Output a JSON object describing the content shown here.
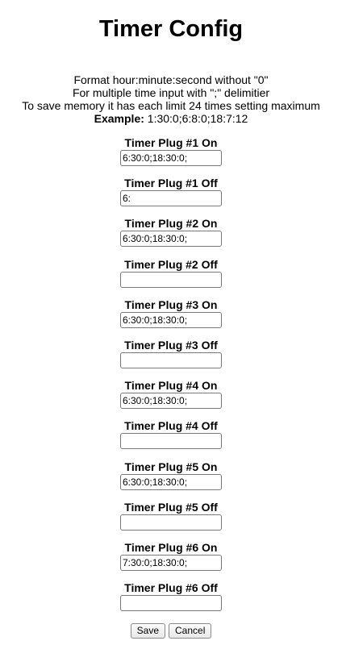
{
  "header": {
    "title": "Timer Config"
  },
  "info": {
    "line1": "Format hour:minute:second without \"0\"",
    "line2": "For multiple time input with \";\" delimitier",
    "line3": "To save memory it has each limit 24 times setting maximum",
    "example_label": "Example:",
    "example_value": " 1:30:0;6:8:0;18:7:12"
  },
  "plugs": [
    {
      "label": "Timer Plug #1 On",
      "value": "6:30:0;18:30:0;"
    },
    {
      "label": "Timer Plug #1 Off",
      "value": "6:"
    },
    {
      "label": "Timer Plug #2 On",
      "value": "6:30:0;18:30:0;"
    },
    {
      "label": "Timer Plug #2 Off",
      "value": ""
    },
    {
      "label": "Timer Plug #3 On",
      "value": "6:30:0;18:30:0;"
    },
    {
      "label": "Timer Plug #3 Off",
      "value": ""
    },
    {
      "label": "Timer Plug #4 On",
      "value": "6:30:0;18:30:0;"
    },
    {
      "label": "Timer Plug #4 Off",
      "value": ""
    },
    {
      "label": "Timer Plug #5 On",
      "value": "6:30:0;18:30:0;"
    },
    {
      "label": "Timer Plug #5 Off",
      "value": ""
    },
    {
      "label": "Timer Plug #6 On",
      "value": "7:30:0;18:30:0;"
    },
    {
      "label": "Timer Plug #6 Off",
      "value": ""
    }
  ],
  "actions": {
    "save_label": "Save",
    "cancel_label": "Cancel"
  }
}
